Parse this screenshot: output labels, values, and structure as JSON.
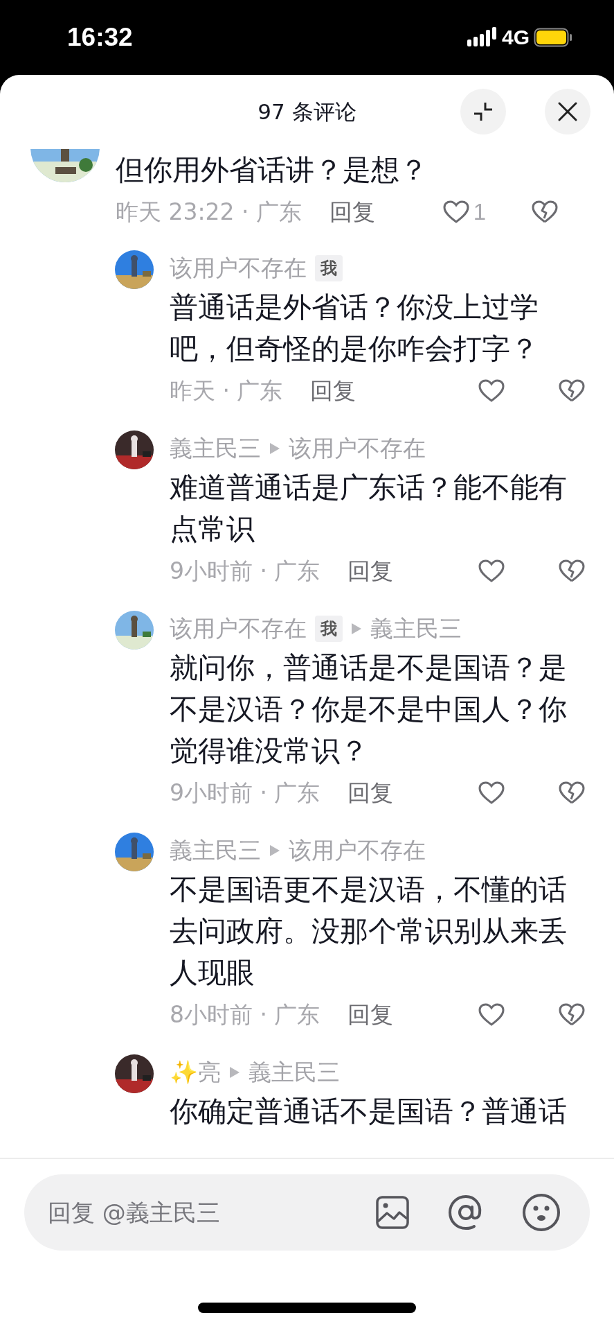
{
  "status_bar": {
    "time": "16:32",
    "network": "4G"
  },
  "header": {
    "title": "97 条评论"
  },
  "top_comment": {
    "text": "但你用外省话讲？是想？",
    "meta": "昨天 23:22 · 广东",
    "reply_label": "回复",
    "likes": "1"
  },
  "replies": [
    {
      "author": "该用户不存在",
      "badge": "我",
      "text": "普通话是外省话？你没上过学吧，但奇怪的是你咋会打字？",
      "meta": "昨天 · 广东",
      "reply_label": "回复"
    },
    {
      "author": "義主民三",
      "reply_to": "该用户不存在",
      "text": "难道普通话是广东话？能不能有点常识",
      "meta": "9小时前 · 广东",
      "reply_label": "回复"
    },
    {
      "author": "该用户不存在",
      "badge": "我",
      "reply_to": "義主民三",
      "text": "就问你，普通话是不是国语？是不是汉语？你是不是中国人？你觉得谁没常识？",
      "meta": "9小时前 · 广东",
      "reply_label": "回复"
    },
    {
      "author": "義主民三",
      "reply_to": "该用户不存在",
      "text": "不是国语更不是汉语，不懂的话去问政府。没那个常识别从来丢人现眼",
      "meta": "8小时前 · 广东",
      "reply_label": "回复"
    },
    {
      "author": "✨亮",
      "reply_to": "義主民三",
      "text": "你确定普通话不是国语？普通话"
    }
  ],
  "input": {
    "placeholder": "回复 @義主民三"
  }
}
